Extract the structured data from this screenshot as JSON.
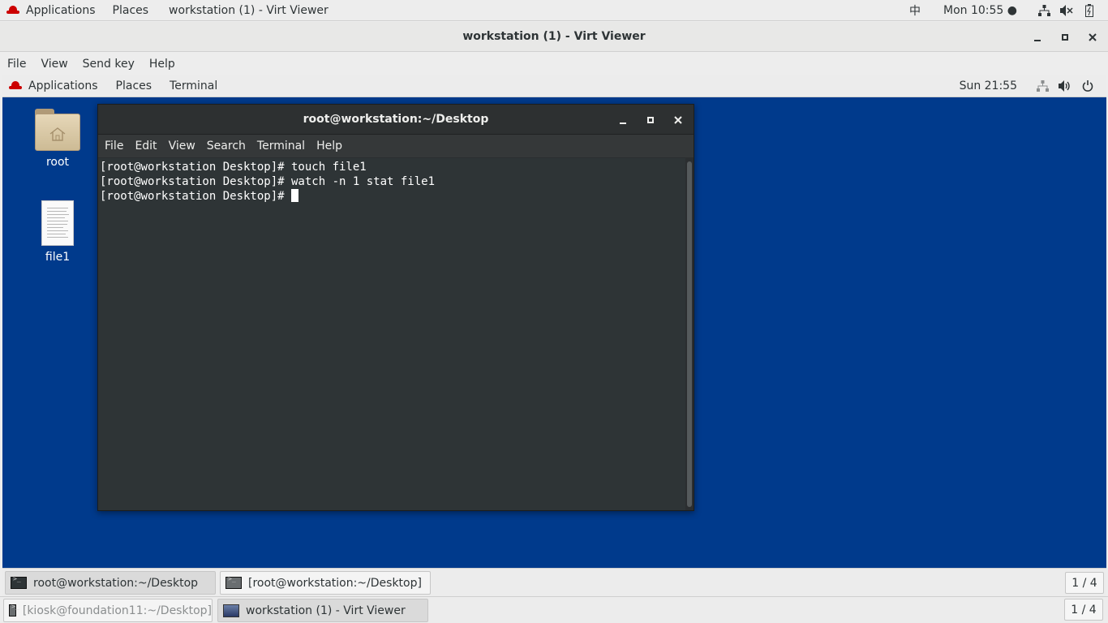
{
  "host_topbar": {
    "applications": "Applications",
    "places": "Places",
    "window_title": "workstation (1) - Virt Viewer",
    "input_method": "中",
    "clock": "Mon 10:55 ●"
  },
  "viewer": {
    "title": "workstation (1) - Virt Viewer",
    "menu": [
      "File",
      "View",
      "Send key",
      "Help"
    ]
  },
  "guest_topbar": {
    "applications": "Applications",
    "places": "Places",
    "terminal": "Terminal",
    "clock": "Sun 21:55"
  },
  "desktop_icons": [
    {
      "label": "root"
    },
    {
      "label": "file1"
    }
  ],
  "terminal": {
    "title": "root@workstation:~/Desktop",
    "menu": [
      "File",
      "Edit",
      "View",
      "Search",
      "Terminal",
      "Help"
    ],
    "lines": [
      "[root@workstation Desktop]# touch file1",
      "[root@workstation Desktop]# watch -n 1 stat file1",
      "[root@workstation Desktop]# "
    ]
  },
  "guest_taskbar": {
    "tasks": [
      "root@workstation:~/Desktop",
      "[root@workstation:~/Desktop]"
    ],
    "pager": "1 / 4"
  },
  "host_taskbar": {
    "tasks": [
      "[kiosk@foundation11:~/Desktop]",
      "workstation (1) - Virt Viewer"
    ],
    "pager": "1 / 4"
  }
}
